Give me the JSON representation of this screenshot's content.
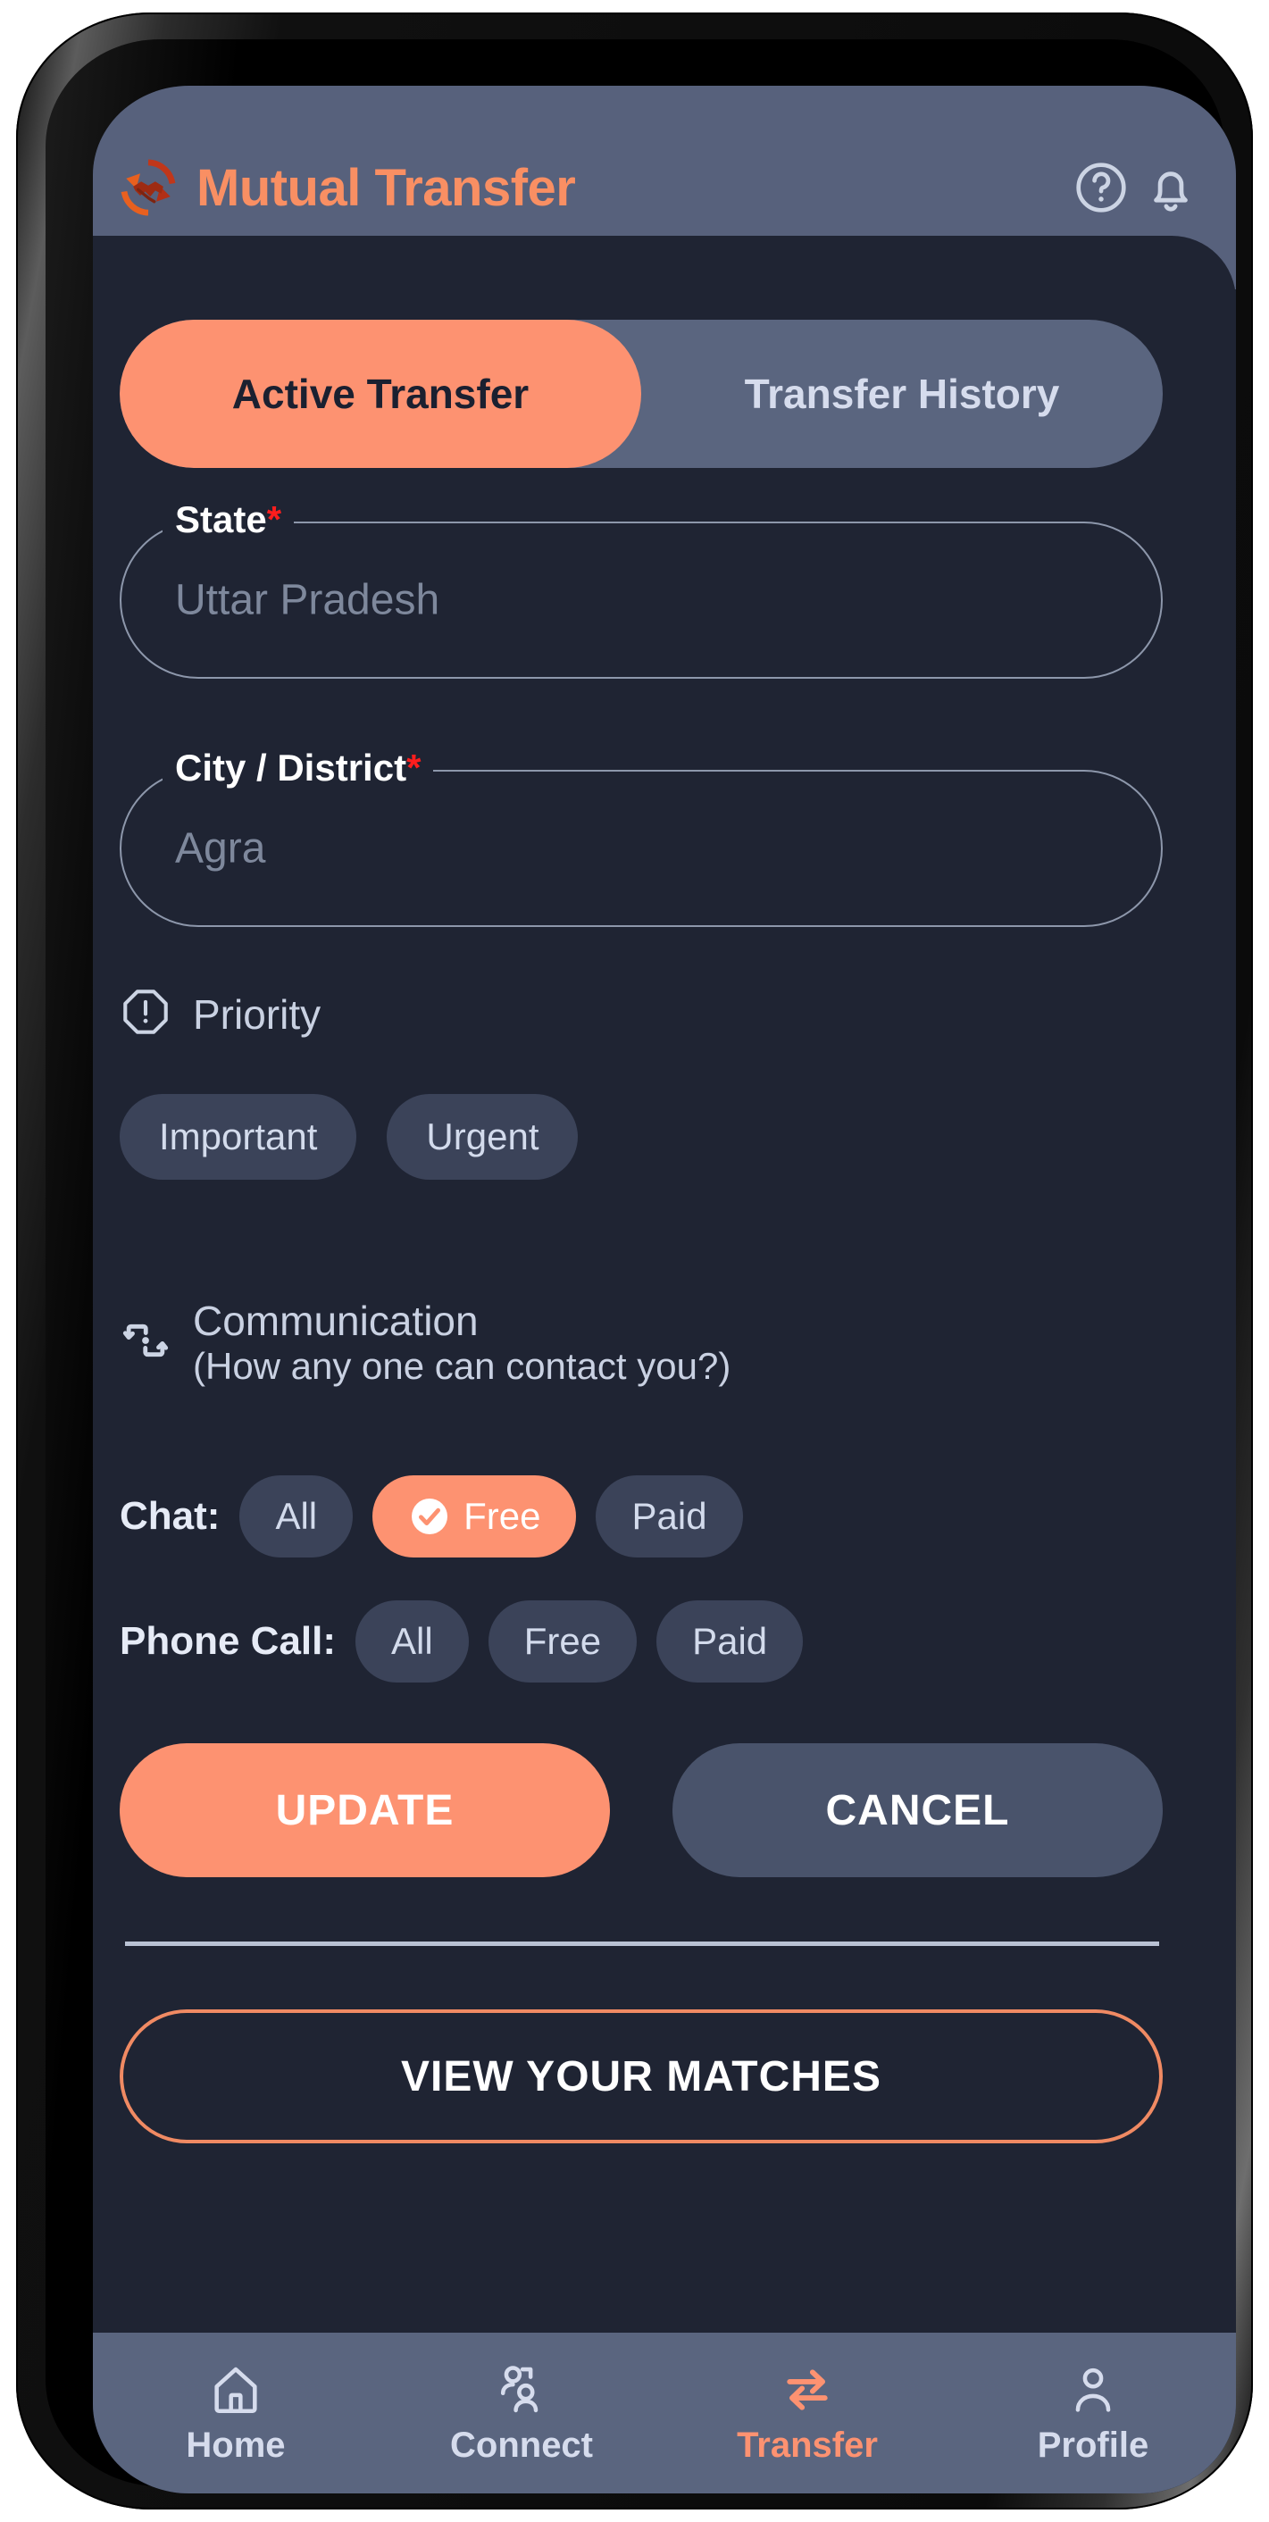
{
  "header": {
    "title": "Mutual Transfer",
    "logo_icon": "handshake-exchange-logo",
    "help_icon": "help-circle-icon",
    "bell_icon": "notification-bell-icon",
    "bg_color": "#57617c",
    "title_color": "#f98f63"
  },
  "tabs": {
    "items": [
      {
        "label": "Active Transfer",
        "active": true
      },
      {
        "label": "Transfer History",
        "active": false
      }
    ],
    "active_bg": "#fd9271",
    "track_bg": "#5a657f"
  },
  "form": {
    "state": {
      "label": "State",
      "required_mark": "*",
      "placeholder": "Uttar Pradesh",
      "value": ""
    },
    "city": {
      "label": "City / District",
      "required_mark": "*",
      "placeholder": "Agra",
      "value": ""
    }
  },
  "priority": {
    "title": "Priority",
    "icon": "alert-octagon-icon",
    "options": [
      {
        "label": "Important",
        "selected": false
      },
      {
        "label": "Urgent",
        "selected": false
      }
    ]
  },
  "communication": {
    "icon": "exchange-arrows-icon",
    "title": "Communication",
    "subtitle": "(How any one can contact you?)",
    "chat": {
      "label": "Chat:",
      "options": [
        {
          "label": "All",
          "selected": false
        },
        {
          "label": "Free",
          "selected": true,
          "icon": "check-circle-icon"
        },
        {
          "label": "Paid",
          "selected": false
        }
      ]
    },
    "phone_call": {
      "label": "Phone Call:",
      "options": [
        {
          "label": "All",
          "selected": false
        },
        {
          "label": "Free",
          "selected": false
        },
        {
          "label": "Paid",
          "selected": false
        }
      ]
    }
  },
  "actions": {
    "update_label": "UPDATE",
    "cancel_label": "CANCEL",
    "matches_label": "VIEW YOUR MATCHES"
  },
  "bottom_nav": {
    "items": [
      {
        "label": "Home",
        "icon": "home-icon",
        "active": false
      },
      {
        "label": "Connect",
        "icon": "people-icon",
        "active": false
      },
      {
        "label": "Transfer",
        "icon": "transfer-arrows-icon",
        "active": true
      },
      {
        "label": "Profile",
        "icon": "person-icon",
        "active": false
      }
    ],
    "active_color": "#fd9271",
    "bg_color": "#5a657f"
  },
  "theme": {
    "accent": "#fd9271",
    "screen_bg": "#1f2433",
    "chip_bg": "#3b4359",
    "required_color": "#ff1d1d"
  }
}
